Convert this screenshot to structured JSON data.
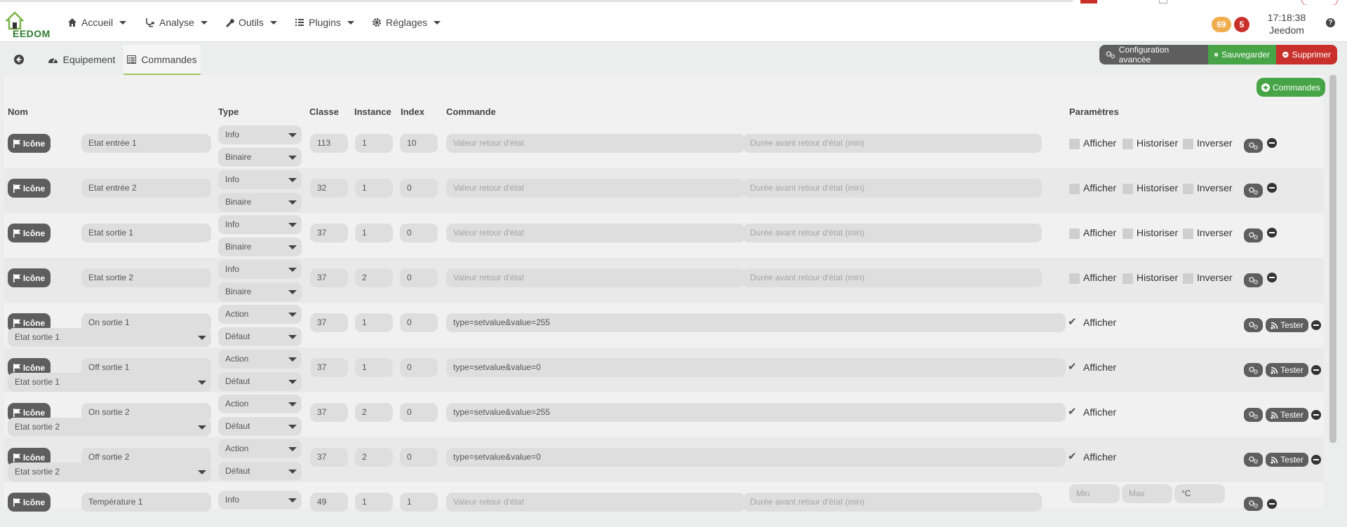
{
  "app": {
    "logo_text": "EEDOM"
  },
  "nav": {
    "menus": [
      {
        "label": "Accueil",
        "icon": "home-icon"
      },
      {
        "label": "Analyse",
        "icon": "stethoscope-icon"
      },
      {
        "label": "Outils",
        "icon": "wrench-icon"
      },
      {
        "label": "Plugins",
        "icon": "list-icon"
      },
      {
        "label": "Réglages",
        "icon": "gear-icon"
      }
    ],
    "badges": [
      "69",
      "5"
    ],
    "time": "17:18:38",
    "user": "Jeedom",
    "help": "?"
  },
  "tabs": {
    "equipement": "Equipement",
    "commandes": "Commandes"
  },
  "toolbar": {
    "config": "Configuration avancée",
    "save": "Sauvegarder",
    "delete": "Supprimer",
    "add_commands": "Commandes"
  },
  "headers": {
    "nom": "Nom",
    "type": "Type",
    "classe": "Classe",
    "instance": "Instance",
    "index": "Index",
    "commande": "Commande",
    "parametres": "Paramètres"
  },
  "labels": {
    "icon_btn": "Icône",
    "afficher": "Afficher",
    "historiser": "Historiser",
    "inverser": "Inverser",
    "tester": "Tester",
    "valeur_ph": "Valeur retour d'état",
    "duree_ph": "Durée avant retour d'état (min)",
    "min_ph": "Min",
    "max_ph": "Max",
    "unit": "°C"
  },
  "rows": [
    {
      "name": "Etat entrée 1",
      "type": "Info",
      "subtype": "Binaire",
      "classe": "113",
      "instance": "1",
      "index": "10"
    },
    {
      "name": "Etat entrée 2",
      "type": "Info",
      "subtype": "Binaire",
      "classe": "32",
      "instance": "1",
      "index": "0"
    },
    {
      "name": "Etat sortie 1",
      "type": "Info",
      "subtype": "Binaire",
      "classe": "37",
      "instance": "1",
      "index": "0"
    },
    {
      "name": "Etat sortie 2",
      "type": "Info",
      "subtype": "Binaire",
      "classe": "37",
      "instance": "2",
      "index": "0"
    },
    {
      "name": "On sortie 1",
      "linked": "Etat sortie 1",
      "type": "Action",
      "subtype": "Défaut",
      "classe": "37",
      "instance": "1",
      "index": "0",
      "command": "type=setvalue&value=255"
    },
    {
      "name": "Off sortie 1",
      "linked": "Etat sortie 1",
      "type": "Action",
      "subtype": "Défaut",
      "classe": "37",
      "instance": "1",
      "index": "0",
      "command": "type=setvalue&value=0"
    },
    {
      "name": "On sortie 2",
      "linked": "Etat sortie 2",
      "type": "Action",
      "subtype": "Défaut",
      "classe": "37",
      "instance": "2",
      "index": "0",
      "command": "type=setvalue&value=255"
    },
    {
      "name": "Off sortie 2",
      "linked": "Etat sortie 2",
      "type": "Action",
      "subtype": "Défaut",
      "classe": "37",
      "instance": "2",
      "index": "0",
      "command": "type=setvalue&value=0"
    },
    {
      "name": "Température 1",
      "type": "Info",
      "classe": "49",
      "instance": "1",
      "index": "1"
    }
  ],
  "colors": {
    "accent_green": "#47a447",
    "danger_red": "#c9302c",
    "badge_orange": "#f0ad4e",
    "badge_red": "#d9534f",
    "dark_button": "#5e5e5e"
  }
}
